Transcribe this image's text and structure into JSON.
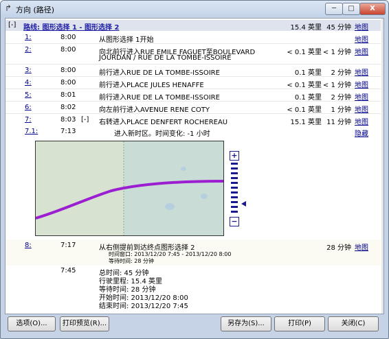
{
  "window": {
    "title": "方向 (路径)",
    "min_label": "─",
    "max_label": "□",
    "close_label": "X"
  },
  "route": {
    "toggle": "[-]",
    "name": "路线: 图形选择 1 - 图形选择 2",
    "distance": "15.4 英里",
    "time": "45 分钟",
    "map_link": "地图"
  },
  "steps": [
    {
      "num": "1:",
      "time": "8:00",
      "flag": "",
      "desc": [
        "从图形选择 1开始"
      ],
      "distance": "",
      "duration": "",
      "map": "地图"
    },
    {
      "num": "2:",
      "time": "8:00",
      "flag": "",
      "desc": [
        "向北前行进入RUE EMILE FAGUET至BOULEVARD",
        "JOURDAN / RUE DE LA TOMBE-ISSOIRE"
      ],
      "distance": "< 0.1 英里",
      "duration": "< 1 分钟",
      "map": "地图"
    },
    {
      "num": "3:",
      "time": "8:00",
      "flag": "",
      "desc": [
        "前行进入RUE DE LA TOMBE-ISSOIRE"
      ],
      "distance": "0.1 英里",
      "duration": "2 分钟",
      "map": "地图"
    },
    {
      "num": "4:",
      "time": "8:00",
      "flag": "",
      "desc": [
        "前行进入PLACE JULES HENAFFE"
      ],
      "distance": "< 0.1 英里",
      "duration": "< 1 分钟",
      "map": "地图"
    },
    {
      "num": "5:",
      "time": "8:01",
      "flag": "",
      "desc": [
        "前行进入RUE DE LA TOMBE-ISSOIRE"
      ],
      "distance": "0.1 英里",
      "duration": "2 分钟",
      "map": "地图"
    },
    {
      "num": "6:",
      "time": "8:02",
      "flag": "",
      "desc": [
        "向左前行进入AVENUE RENE COTY"
      ],
      "distance": "< 0.1 英里",
      "duration": "1 分钟",
      "map": "地图"
    },
    {
      "num": "7:",
      "time": "8:03",
      "flag": "[-]",
      "desc": [
        "右转进入PLACE DENFERT ROCHEREAU"
      ],
      "distance": "15.1 英里",
      "duration": "11 分钟",
      "map": "地图"
    }
  ],
  "substep": {
    "num": "7.1:",
    "time": "7:13",
    "desc": "进入新时区。时间变化: -1 小时",
    "hide": "隐藏"
  },
  "zoom": {
    "in": "+",
    "out": "−",
    "level": 0.15
  },
  "arrival": {
    "num": "8:",
    "time": "7:17",
    "desc": "从右侧提前到达终点图形选择 2",
    "window": "时间窗口: 2013/12/20 7:45 - 2013/12/20 8:00",
    "wait": "等待时间: 28 分钟",
    "duration": "28 分钟",
    "map": "地图"
  },
  "summary": {
    "time": "7:45",
    "lines": [
      "总时间: 45 分钟",
      "行驶里程: 15.4 英里",
      "等待时间: 28 分钟",
      "开始时间: 2013/12/20 8:00",
      "结束时间: 2013/12/20 7:45"
    ]
  },
  "buttons": {
    "options": "选项(O)...",
    "print_preview": "打印预览(R)...",
    "save_as": "另存为(S)...",
    "print": "打印(P)",
    "close": "关闭(C)"
  }
}
